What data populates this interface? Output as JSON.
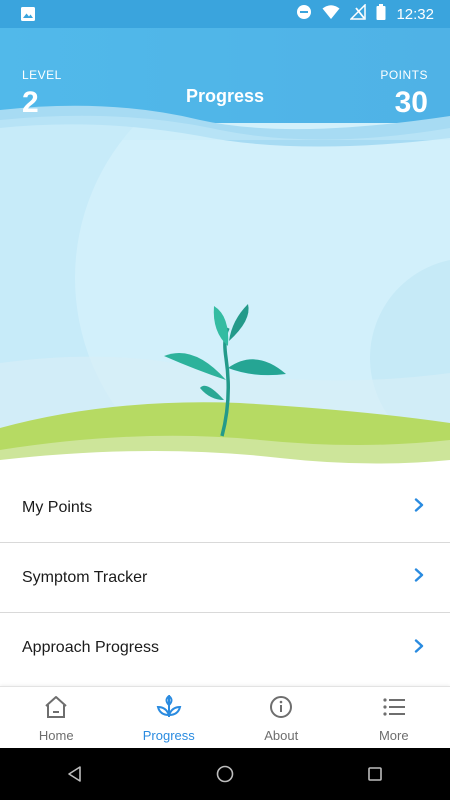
{
  "status_bar": {
    "time": "12:32"
  },
  "header": {
    "level_label": "LEVEL",
    "level_value": "2",
    "title": "Progress",
    "points_label": "POINTS",
    "points_value": "30"
  },
  "list": {
    "items": [
      {
        "label": "My Points"
      },
      {
        "label": "Symptom Tracker"
      },
      {
        "label": "Approach Progress"
      }
    ]
  },
  "bottom_nav": {
    "items": [
      {
        "label": "Home",
        "icon": "home-icon"
      },
      {
        "label": "Progress",
        "icon": "sprout-icon"
      },
      {
        "label": "About",
        "icon": "info-icon"
      },
      {
        "label": "More",
        "icon": "list-icon"
      }
    ],
    "active": "Progress"
  },
  "colors": {
    "accent": "#2a8be0",
    "sky": "#c4e9f8",
    "header": "#47b0e6",
    "grass": "#b6da63"
  }
}
